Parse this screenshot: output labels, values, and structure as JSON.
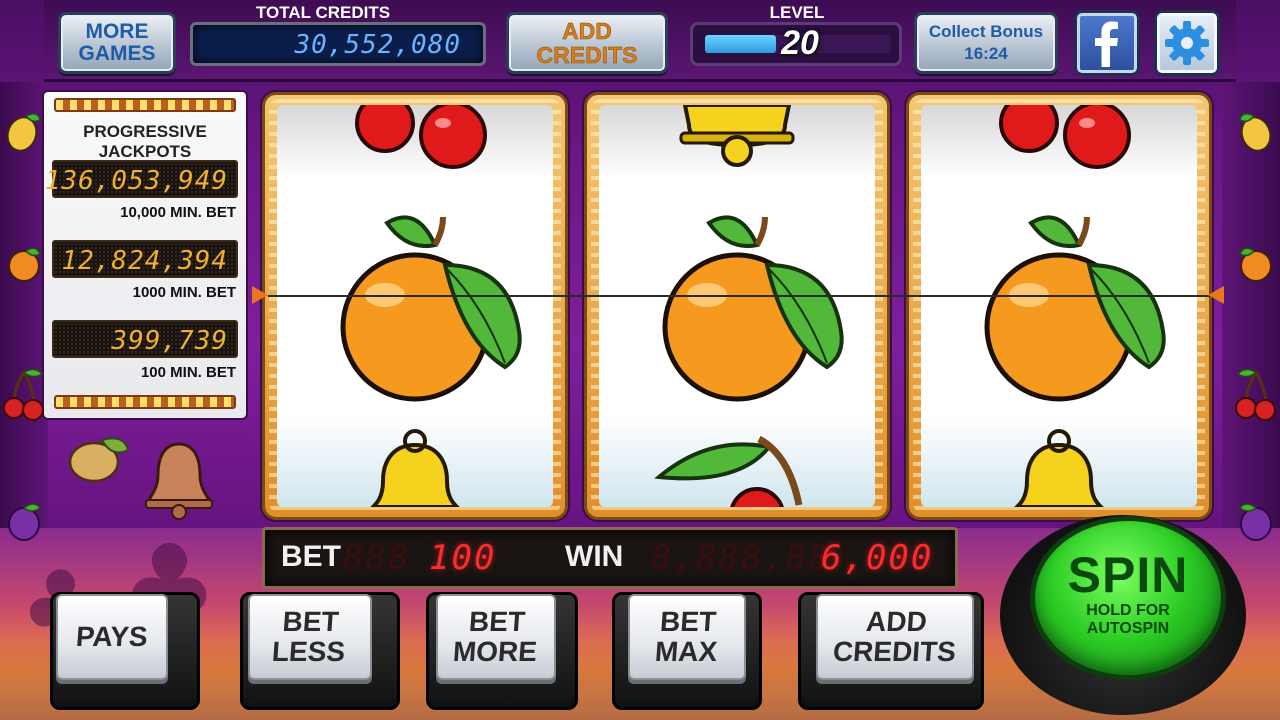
{
  "top_bar": {
    "more_games": "MORE\nGAMES",
    "total_credits_label": "TOTAL CREDITS",
    "total_credits_value": "30,552,080",
    "add_credits": "ADD\nCREDITS",
    "level_label": "LEVEL",
    "level_value": "20",
    "level_progress": 0.38,
    "collect_bonus": "Collect Bonus\n16:24",
    "facebook_icon": "facebook-icon",
    "settings_icon": "gear-icon"
  },
  "jackpots": {
    "title": "PROGRESSIVE JACKPOTS",
    "items": [
      {
        "value": "136,053,949",
        "bet": "10,000 MIN. BET"
      },
      {
        "value": "12,824,394",
        "bet": "1000 MIN. BET"
      },
      {
        "value": "399,739",
        "bet": "100 MIN. BET"
      }
    ]
  },
  "reels": [
    {
      "top": "cherry",
      "middle": "orange",
      "bottom": "bell"
    },
    {
      "top": "bell",
      "middle": "orange",
      "bottom": "cherry"
    },
    {
      "top": "cherry",
      "middle": "orange",
      "bottom": "bell"
    }
  ],
  "display": {
    "bet_label": "BET",
    "bet_ghost": "888",
    "bet_value": "100",
    "win_label": "WIN",
    "win_ghost": "8,888,88",
    "win_value": "6,000"
  },
  "buttons": {
    "pays": "PAYS",
    "bet_less": "BET\nLESS",
    "bet_more": "BET\nMORE",
    "bet_max": "BET\nMAX",
    "add_credits": "ADD\nCREDITS"
  },
  "spin": {
    "label": "SPIN",
    "sub": "HOLD FOR\nAUTOSPIN"
  },
  "colors": {
    "background": "#6b1787",
    "led_red": "#ff2a2a",
    "led_amber": "#f3b12a",
    "credits_blue": "#66b6ff",
    "spin_green": "#2fcf26"
  }
}
